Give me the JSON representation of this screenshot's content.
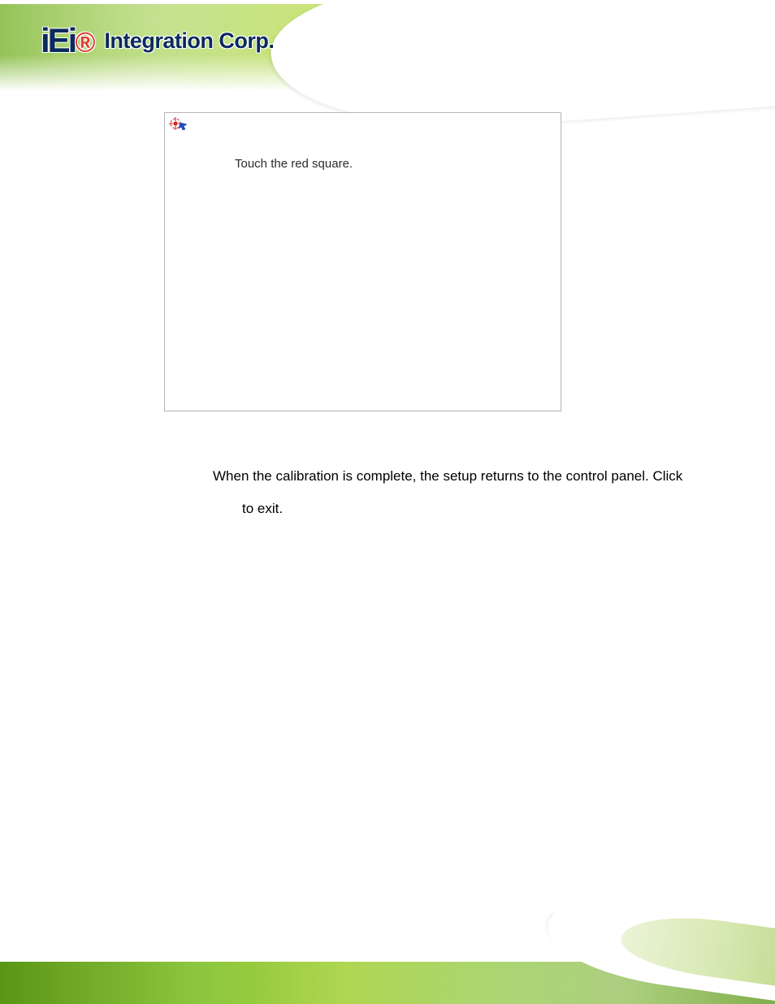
{
  "brand": {
    "logo_mark": "iEi",
    "logo_dot": "®",
    "logo_text": "Integration Corp."
  },
  "calibration": {
    "instruction": "Touch the red square."
  },
  "body": {
    "line1": "When the calibration is complete, the setup returns to the control panel. Click",
    "line2_indent": "to exit."
  }
}
